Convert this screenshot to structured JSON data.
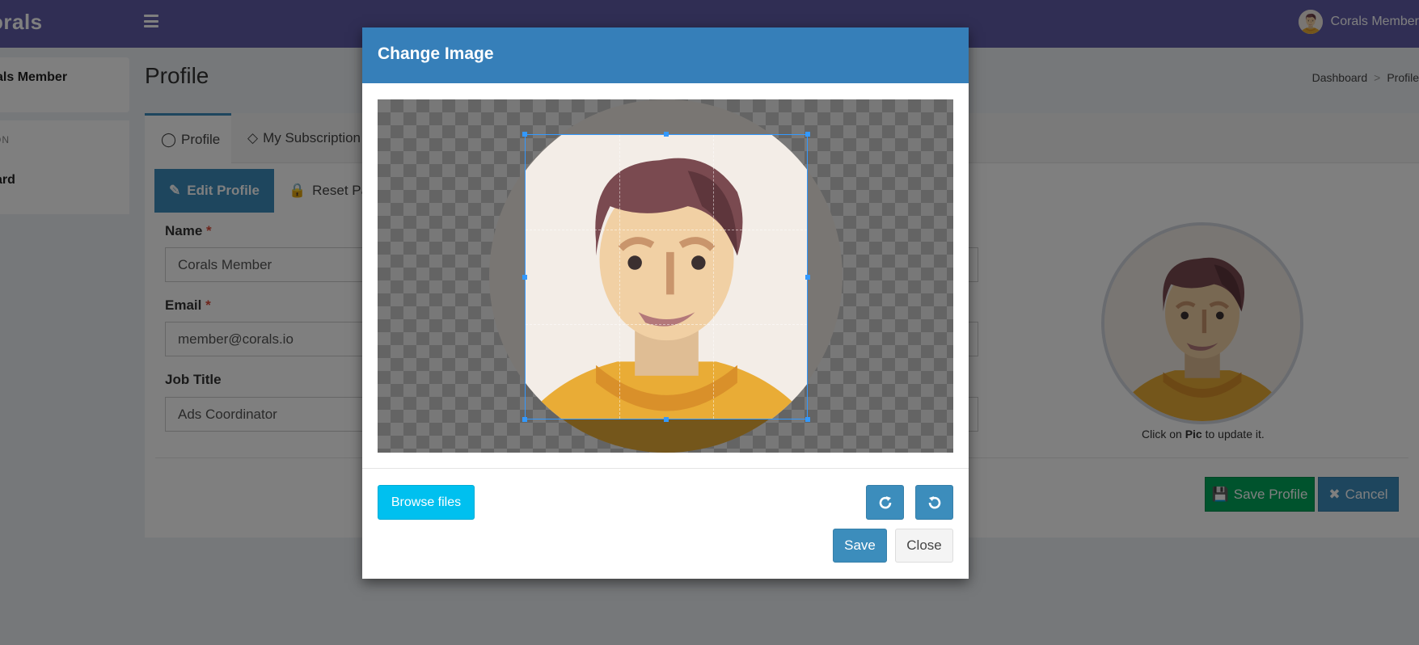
{
  "app": {
    "brand": "orals",
    "user_name": "Corals Member"
  },
  "sidebar": {
    "user_name": "als Member",
    "section_header": "ON",
    "item_dashboard": "ard"
  },
  "page": {
    "title": "Profile",
    "breadcrumb": [
      "Dashboard",
      "Profile"
    ]
  },
  "tabs": [
    {
      "label": "Profile",
      "icon": "user-icon",
      "active": true
    },
    {
      "label": "My Subscription",
      "icon": "diamond-icon",
      "active": false
    }
  ],
  "subtabs": [
    {
      "label": "Edit Profile",
      "icon": "pencil-icon",
      "active": true
    },
    {
      "label": "Reset Pas",
      "icon": "lock-icon",
      "active": false
    }
  ],
  "form": {
    "name_label": "Name",
    "name_value": "Corals Member",
    "email_label": "Email",
    "email_value": "member@corals.io",
    "job_label": "Job Title",
    "job_value": "Ads Coordinator",
    "required_mark": "*"
  },
  "avatar_hint": {
    "prefix": "Click on",
    "bold": "Pic",
    "suffix": "to update it."
  },
  "actions": {
    "save_profile": "Save Profile",
    "cancel": "Cancel"
  },
  "modal": {
    "title": "Change Image",
    "browse_label": "Browse files",
    "rotate_right_icon": "rotate-right-icon",
    "rotate_left_icon": "rotate-left-icon",
    "save_label": "Save",
    "close_label": "Close"
  },
  "colors": {
    "topbar": "#605ca8",
    "primary": "#3c8dbc",
    "modal_header": "#367fb9",
    "success": "#00a65a",
    "info": "#00c0ef",
    "danger": "#dd4b39"
  }
}
